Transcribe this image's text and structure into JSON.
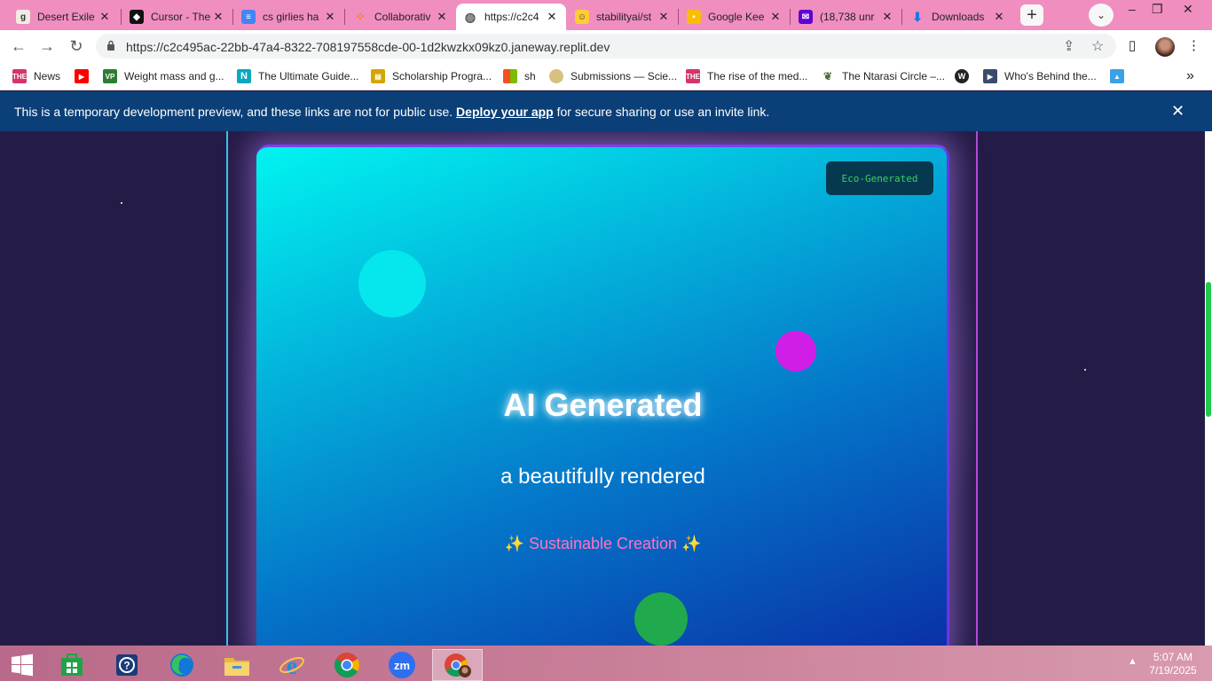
{
  "browser": {
    "tabs": [
      {
        "title": "Desert Exile",
        "icon": "goodreads-icon",
        "color": "#eee"
      },
      {
        "title": "Cursor - The",
        "icon": "cursor-icon",
        "color": "#111"
      },
      {
        "title": "cs girlies ha",
        "icon": "docs-icon",
        "color": "#4285f4"
      },
      {
        "title": "Collaborativ",
        "icon": "collab-icon",
        "color": "#f57c00"
      },
      {
        "title": "https://c2c4",
        "icon": "globe-icon",
        "color": "#555"
      },
      {
        "title": "stabilityai/st",
        "icon": "huggingface-icon",
        "color": "#ffcc33"
      },
      {
        "title": "Google Kee",
        "icon": "keep-icon",
        "color": "#fbbc04"
      },
      {
        "title": "(18,738 unr",
        "icon": "mail-icon",
        "color": "#6001d2"
      },
      {
        "title": "Downloads",
        "icon": "download-icon",
        "color": "#1a73e8"
      }
    ],
    "active_tab_index": 4,
    "url": "https://c2c495ac-22bb-47a4-8322-708197558cde-00-1d2kwzkx09kz0.janeway.replit.dev",
    "bookmarks": [
      {
        "label": "News",
        "icon": "the-icon",
        "color": "#d6336c"
      },
      {
        "label": "",
        "icon": "youtube-icon",
        "color": "#ff0000"
      },
      {
        "label": "Weight mass and g...",
        "icon": "vp-icon",
        "color": "#2e7d32"
      },
      {
        "label": "The Ultimate Guide...",
        "icon": "n-icon",
        "color": "#0aa8c2"
      },
      {
        "label": "Scholarship Progra...",
        "icon": "scholarship-icon",
        "color": "#d4a600"
      },
      {
        "label": "sh",
        "icon": "microsoft-icon",
        "color": "#f25022"
      },
      {
        "label": "Submissions — Scie...",
        "icon": "submissions-icon",
        "color": "#d8c080"
      },
      {
        "label": "The rise of the med...",
        "icon": "the-icon",
        "color": "#d6336c"
      },
      {
        "label": "The Ntarasi Circle –...",
        "icon": "ntarasi-icon",
        "color": "#4e6b3c"
      },
      {
        "label": "",
        "icon": "wordpress-icon",
        "color": "#222"
      },
      {
        "label": "Who's Behind the...",
        "icon": "tag-icon",
        "color": "#3c4a6b"
      },
      {
        "label": "",
        "icon": "landscape-icon",
        "color": "#3aa0e8"
      }
    ]
  },
  "banner": {
    "text_before": "This is a temporary development preview, and these links are not for public use.",
    "link": "Deploy your app",
    "text_after": "for secure sharing or use an invite link."
  },
  "card": {
    "badge": "Eco-Generated",
    "headline": "AI Generated",
    "subline": "a beautifully rendered",
    "tagline": "Sustainable Creation",
    "sparkle": "✨"
  },
  "taskbar": {
    "apps": [
      "windows-start-icon",
      "store-icon",
      "help-icon",
      "edge-icon",
      "file-explorer-icon",
      "ie-icon",
      "chrome-icon",
      "zoom-icon",
      "chrome-profile-icon"
    ],
    "zoom_label": "zm",
    "time": "5:07 AM",
    "date": "7/19/2025"
  },
  "colors": {
    "tabstrip": "#f08ec0",
    "banner": "#0b3f78",
    "badge_text": "#36d35d",
    "tagline": "#ff73c4",
    "circle_cyan": "#05e7ec",
    "circle_magenta": "#d11ee6",
    "circle_green": "#20a94d"
  }
}
